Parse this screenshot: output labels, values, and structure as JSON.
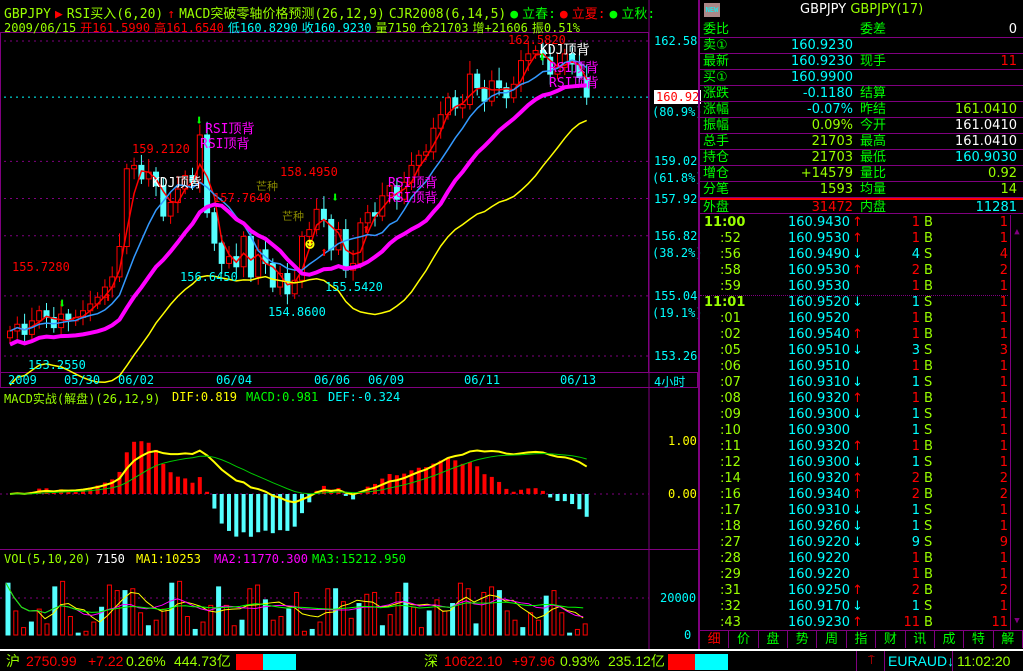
{
  "header": {
    "symbol": "GBPJPY",
    "rsi": "RSI买入(6,20)",
    "macd_pred": "MACD突破零轴价格预测(26,12,9)",
    "cjr": "CJR2008(6,14,5)",
    "lichun": "立春:",
    "lixia": "立夏:",
    "liqiu": "立秋:",
    "date": "2009/06/15",
    "open": "开161.5990",
    "high": "高161.6540",
    "low": "低160.8290",
    "close": "收160.9230",
    "vol": "量7150",
    "oi": "仓21703",
    "inc": "增+21606",
    "amp": "振0.51%"
  },
  "price_axis": {
    "ticks": [
      "162.58",
      "159.02",
      "157.92",
      "156.82",
      "155.04",
      "153.26"
    ],
    "fibs": [
      "(80.9%)",
      "(61.8%)",
      "(38.2%)",
      "(19.1%)"
    ],
    "current": "160.92"
  },
  "annotations": {
    "hi1": "155.7280",
    "lo1": "153.2550",
    "hi2": "159.2120",
    "mid": "156.6450",
    "ma": "157.7640",
    "hi3": "158.4950",
    "lo2": "154.8600",
    "lo3": "155.5420",
    "hi4": "162.5820",
    "kdj_top": "KDJ顶背",
    "rsi_top": "RSI顶背",
    "mang": "芒种"
  },
  "date_axis": {
    "labels": [
      "2009",
      "05/30",
      "06/02",
      "06/04",
      "06/06",
      "06/09",
      "06/11",
      "06/13"
    ],
    "period": "4小时"
  },
  "macd_panel": {
    "title": "MACD实战(解盘)(26,12,9)",
    "dif": "DIF:0.819",
    "macd": "MACD:0.981",
    "def": "DEF:-0.324",
    "ticks": [
      "1.00",
      "0.00"
    ]
  },
  "vol_panel": {
    "title": "VOL(5,10,20)",
    "vol": "7150",
    "ma1": "MA1:10253",
    "ma2": "MA2:11770.300",
    "ma3": "MA3:15212.950",
    "ticks": [
      "20000",
      "0"
    ]
  },
  "chart_data": {
    "type": "candlestick",
    "closes": [
      154.0,
      154.2,
      153.9,
      154.3,
      154.6,
      154.4,
      154.1,
      154.5,
      154.3,
      154.4,
      154.6,
      154.8,
      155.0,
      155.3,
      155.6,
      156.5,
      158.8,
      158.9,
      158.5,
      158.7,
      158.3,
      157.4,
      157.8,
      158.2,
      158.6,
      158.4,
      159.8,
      157.5,
      156.6,
      156.0,
      156.2,
      155.9,
      156.8,
      155.6,
      156.4,
      156.0,
      155.3,
      155.7,
      155.1,
      155.5,
      156.8,
      157.0,
      157.6,
      157.3,
      156.4,
      157.0,
      155.8,
      156.0,
      157.2,
      157.5,
      157.4,
      158.0,
      158.3,
      157.9,
      158.4,
      158.9,
      159.2,
      159.3,
      160.0,
      160.4,
      160.9,
      160.6,
      160.7,
      161.6,
      161.2,
      160.8,
      161.4,
      161.2,
      160.9,
      161.3,
      162.0,
      162.2,
      162.3,
      162.1,
      161.6,
      161.8,
      162.2,
      161.9,
      161.5,
      160.92
    ],
    "volumes": [
      28000,
      13000,
      4000,
      7000,
      14000,
      6000,
      26000,
      29000,
      10000,
      1000,
      2000,
      7000,
      15000,
      27000,
      24000,
      24000,
      25000,
      12000,
      5000,
      8000,
      14000,
      28000,
      29000,
      10000,
      3000,
      7000,
      16000,
      26000,
      16000,
      5000,
      8000,
      25000,
      27000,
      19000,
      8000,
      10000,
      14000,
      23000,
      2000,
      3000,
      7000,
      25000,
      25000,
      18000,
      9000,
      17000,
      22000,
      23000,
      5000,
      11000,
      23000,
      28000,
      15000,
      4000,
      13000,
      19000,
      13000,
      17000,
      28000,
      25000,
      6000,
      23000,
      26000,
      24000,
      13000,
      8000,
      4000,
      12000,
      8000,
      21000,
      24000,
      12000,
      1000,
      3000,
      6000
    ]
  },
  "right_panel": {
    "new_badge": "NEW",
    "title1": "GBPJPY",
    "title2": "GBPJPY(17)",
    "quotes": [
      {
        "l": "委比",
        "v": "",
        "l2": "委差",
        "v2": "0",
        "c": "#0f0",
        "c2": "#fff"
      },
      {
        "l": "卖①",
        "v": "160.9230",
        "l2": "",
        "v2": "",
        "c": "#0ff",
        "c2": "#0ff"
      },
      {
        "l": "最新",
        "v": "160.9230",
        "l2": "现手",
        "v2": "11",
        "c": "#0ff",
        "c2": "#f00"
      },
      {
        "l": "买①",
        "v": "160.9900",
        "l2": "",
        "v2": "",
        "c": "#0ff",
        "c2": "#0ff"
      },
      {
        "l": "涨跌",
        "v": "-0.1180",
        "l2": "结算",
        "v2": "",
        "c": "#0ff",
        "c2": "#0ff"
      },
      {
        "l": "涨幅",
        "v": "-0.07%",
        "l2": "昨结",
        "v2": "161.0410",
        "c": "#0ff",
        "c2": "#9f0"
      },
      {
        "l": "振幅",
        "v": "0.09%",
        "l2": "今开",
        "v2": "161.0410",
        "c": "#9f0",
        "c2": "#fff"
      },
      {
        "l": "总手",
        "v": "21703",
        "l2": "最高",
        "v2": "161.0410",
        "c": "#9f0",
        "c2": "#fff"
      },
      {
        "l": "持仓",
        "v": "21703",
        "l2": "最低",
        "v2": "160.9030",
        "c": "#9f0",
        "c2": "#0ff"
      },
      {
        "l": "增仓",
        "v": "+14579",
        "l2": "量比",
        "v2": "0.92",
        "c": "#9f0",
        "c2": "#9f0"
      },
      {
        "l": "分笔",
        "v": "1593",
        "l2": "均量",
        "v2": "14",
        "c": "#9f0",
        "c2": "#9f0"
      },
      {
        "l": "外盘",
        "v": "31472",
        "l2": "内盘",
        "v2": "11281",
        "c": "#f00",
        "c2": "#0ff"
      }
    ],
    "ticks": [
      {
        "t": "11:00",
        "p": "160.9430",
        "d": "↑",
        "n": "1",
        "s": "B",
        "r": "1"
      },
      {
        "t": ":52",
        "p": "160.9530",
        "d": "↑",
        "n": "1",
        "s": "B",
        "r": "1"
      },
      {
        "t": ":56",
        "p": "160.9490",
        "d": "↓",
        "n": "4",
        "s": "S",
        "r": "4"
      },
      {
        "t": ":58",
        "p": "160.9530",
        "d": "↑",
        "n": "2",
        "s": "B",
        "r": "2"
      },
      {
        "t": ":59",
        "p": "160.9530",
        "d": "",
        "n": "1",
        "s": "B",
        "r": "1"
      },
      {
        "t": "11:01",
        "p": "160.9520",
        "d": "↓",
        "n": "1",
        "s": "S",
        "r": "1"
      },
      {
        "t": ":01",
        "p": "160.9520",
        "d": "",
        "n": "1",
        "s": "B",
        "r": "1"
      },
      {
        "t": ":02",
        "p": "160.9540",
        "d": "↑",
        "n": "1",
        "s": "B",
        "r": "1"
      },
      {
        "t": ":05",
        "p": "160.9510",
        "d": "↓",
        "n": "3",
        "s": "S",
        "r": "3"
      },
      {
        "t": ":06",
        "p": "160.9510",
        "d": "",
        "n": "1",
        "s": "B",
        "r": "1"
      },
      {
        "t": ":07",
        "p": "160.9310",
        "d": "↓",
        "n": "1",
        "s": "S",
        "r": "1"
      },
      {
        "t": ":08",
        "p": "160.9320",
        "d": "↑",
        "n": "1",
        "s": "B",
        "r": "1"
      },
      {
        "t": ":09",
        "p": "160.9300",
        "d": "↓",
        "n": "1",
        "s": "S",
        "r": "1"
      },
      {
        "t": ":10",
        "p": "160.9300",
        "d": "",
        "n": "1",
        "s": "S",
        "r": "1"
      },
      {
        "t": ":11",
        "p": "160.9320",
        "d": "↑",
        "n": "1",
        "s": "B",
        "r": "1"
      },
      {
        "t": ":12",
        "p": "160.9300",
        "d": "↓",
        "n": "1",
        "s": "S",
        "r": "1"
      },
      {
        "t": ":14",
        "p": "160.9320",
        "d": "↑",
        "n": "2",
        "s": "B",
        "r": "2"
      },
      {
        "t": ":16",
        "p": "160.9340",
        "d": "↑",
        "n": "2",
        "s": "B",
        "r": "2"
      },
      {
        "t": ":17",
        "p": "160.9310",
        "d": "↓",
        "n": "1",
        "s": "S",
        "r": "1"
      },
      {
        "t": ":18",
        "p": "160.9260",
        "d": "↓",
        "n": "1",
        "s": "S",
        "r": "1"
      },
      {
        "t": ":27",
        "p": "160.9220",
        "d": "↓",
        "n": "9",
        "s": "S",
        "r": "9"
      },
      {
        "t": ":28",
        "p": "160.9220",
        "d": "",
        "n": "1",
        "s": "B",
        "r": "1"
      },
      {
        "t": ":29",
        "p": "160.9220",
        "d": "",
        "n": "1",
        "s": "B",
        "r": "1"
      },
      {
        "t": ":31",
        "p": "160.9250",
        "d": "↑",
        "n": "2",
        "s": "B",
        "r": "2"
      },
      {
        "t": ":32",
        "p": "160.9170",
        "d": "↓",
        "n": "1",
        "s": "S",
        "r": "1"
      },
      {
        "t": ":43",
        "p": "160.9230",
        "d": "↑",
        "n": "11",
        "s": "B",
        "r": "11"
      }
    ],
    "tabs": [
      "细",
      "价",
      "盘",
      "势",
      "周",
      "指",
      "财",
      "讯",
      "成",
      "特",
      "解"
    ]
  },
  "status": {
    "sh_label": "沪",
    "sh_idx": "2750.99",
    "sh_chg": "+7.22",
    "sh_pct": "0.26%",
    "sh_amt": "444.73亿",
    "sz_label": "深",
    "sz_idx": "10622.10",
    "sz_chg": "+97.96",
    "sz_pct": "0.93%",
    "sz_amt": "235.12亿",
    "symbol": "EURAUD↓",
    "time": "11:02:20"
  }
}
